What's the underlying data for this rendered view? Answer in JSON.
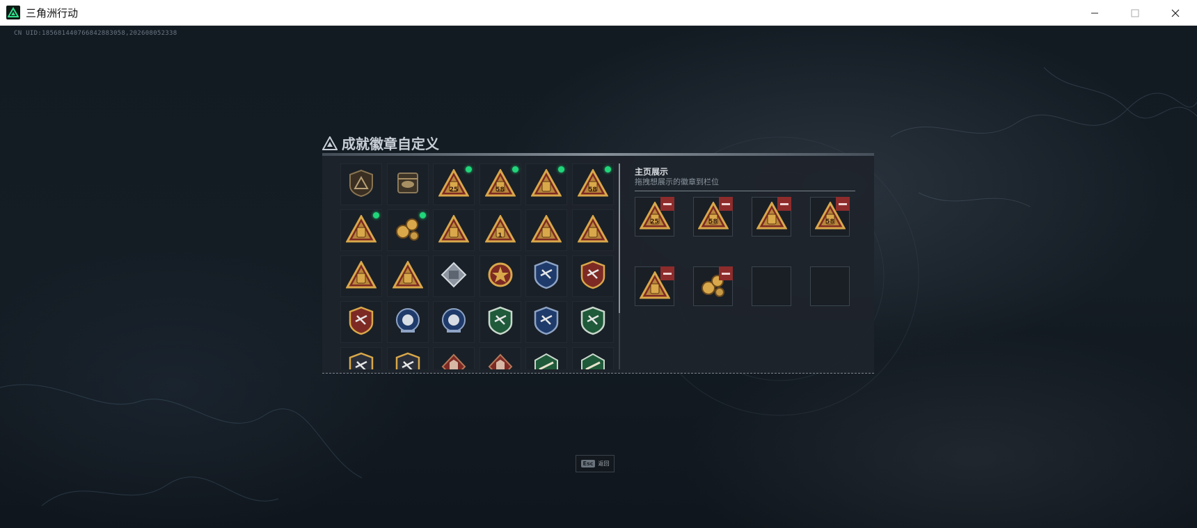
{
  "window": {
    "title": "三角洲行动",
    "controls": {
      "minimize": "—",
      "maximize": "☐",
      "close": "✕"
    }
  },
  "uid_text": "CN UID:185681440766842883058,202608052338",
  "panel": {
    "title": "成就徽章自定义",
    "showcase": {
      "title": "主页展示",
      "subtitle": "拖拽想展示的徽章到栏位",
      "slots": [
        {
          "badge": "triangle-backpack-25",
          "label": "25",
          "removable": true
        },
        {
          "badge": "triangle-backpack-58",
          "label": "58",
          "removable": true
        },
        {
          "badge": "triangle-bag",
          "label": "",
          "removable": true
        },
        {
          "badge": "triangle-backpack-58",
          "label": "58",
          "removable": true
        },
        {
          "badge": "triangle-tower",
          "label": "",
          "removable": true
        },
        {
          "badge": "gear-cluster",
          "label": "",
          "removable": true
        },
        {
          "badge": "empty",
          "label": "",
          "removable": false
        },
        {
          "badge": "empty",
          "label": "",
          "removable": false
        }
      ]
    },
    "badges": [
      {
        "icon": "shield-triangle-icon",
        "label": "",
        "new": false
      },
      {
        "icon": "helicopter-badge-icon",
        "label": "",
        "new": false
      },
      {
        "icon": "triangle-backpack-icon",
        "label": "25",
        "new": true
      },
      {
        "icon": "triangle-backpack-icon",
        "label": "58",
        "new": true
      },
      {
        "icon": "triangle-bag-icon",
        "label": "",
        "new": true
      },
      {
        "icon": "triangle-backpack-icon",
        "label": "58",
        "new": true
      },
      {
        "icon": "triangle-tower-icon",
        "label": "",
        "new": true
      },
      {
        "icon": "gear-cluster-icon",
        "label": "",
        "new": true
      },
      {
        "icon": "triangle-dome-icon",
        "label": "",
        "new": false
      },
      {
        "icon": "triangle-number-icon",
        "label": "1",
        "new": false
      },
      {
        "icon": "triangle-bag-icon",
        "label": "",
        "new": false
      },
      {
        "icon": "triangle-heart-icon",
        "label": "",
        "new": false
      },
      {
        "icon": "triangle-wings-icon",
        "label": "",
        "new": false
      },
      {
        "icon": "triangle-pyramid-icon",
        "label": "",
        "new": false
      },
      {
        "icon": "silver-diamond-icon",
        "label": "",
        "new": false
      },
      {
        "icon": "star-medal-icon",
        "label": "",
        "new": false
      },
      {
        "icon": "blue-shield-wings-icon",
        "label": "",
        "new": false
      },
      {
        "icon": "red-shield-star-icon",
        "label": "",
        "new": false
      },
      {
        "icon": "red-shield-eagle-icon",
        "label": "",
        "new": false
      },
      {
        "icon": "blue-skull-emblem-icon",
        "label": "",
        "new": false
      },
      {
        "icon": "blue-eye-emblem-icon",
        "label": "",
        "new": false
      },
      {
        "icon": "green-plane-shield-icon",
        "label": "",
        "new": false
      },
      {
        "icon": "blue-plane-shield-icon",
        "label": "",
        "new": false
      },
      {
        "icon": "green-rifle-shield-icon",
        "label": "",
        "new": false
      },
      {
        "icon": "gold-rifle-shield-icon",
        "label": "",
        "new": false
      },
      {
        "icon": "blue-gold-shield-icon",
        "label": "",
        "new": false
      },
      {
        "icon": "red-wolf-emblem-icon",
        "label": "",
        "new": false
      },
      {
        "icon": "red-wolf-emblem-icon",
        "label": "",
        "new": false
      },
      {
        "icon": "green-jet-hexagon-icon",
        "label": "",
        "new": false
      },
      {
        "icon": "green-gun-hexagon-icon",
        "label": "",
        "new": false
      }
    ]
  },
  "footer": {
    "esc_key": "Esc",
    "esc_label": "返回"
  },
  "colors": {
    "accent_green": "#21d67a",
    "remove_red": "#8e2c2c",
    "badge_gold": "#d9a84a",
    "badge_red": "#7e2a24"
  }
}
